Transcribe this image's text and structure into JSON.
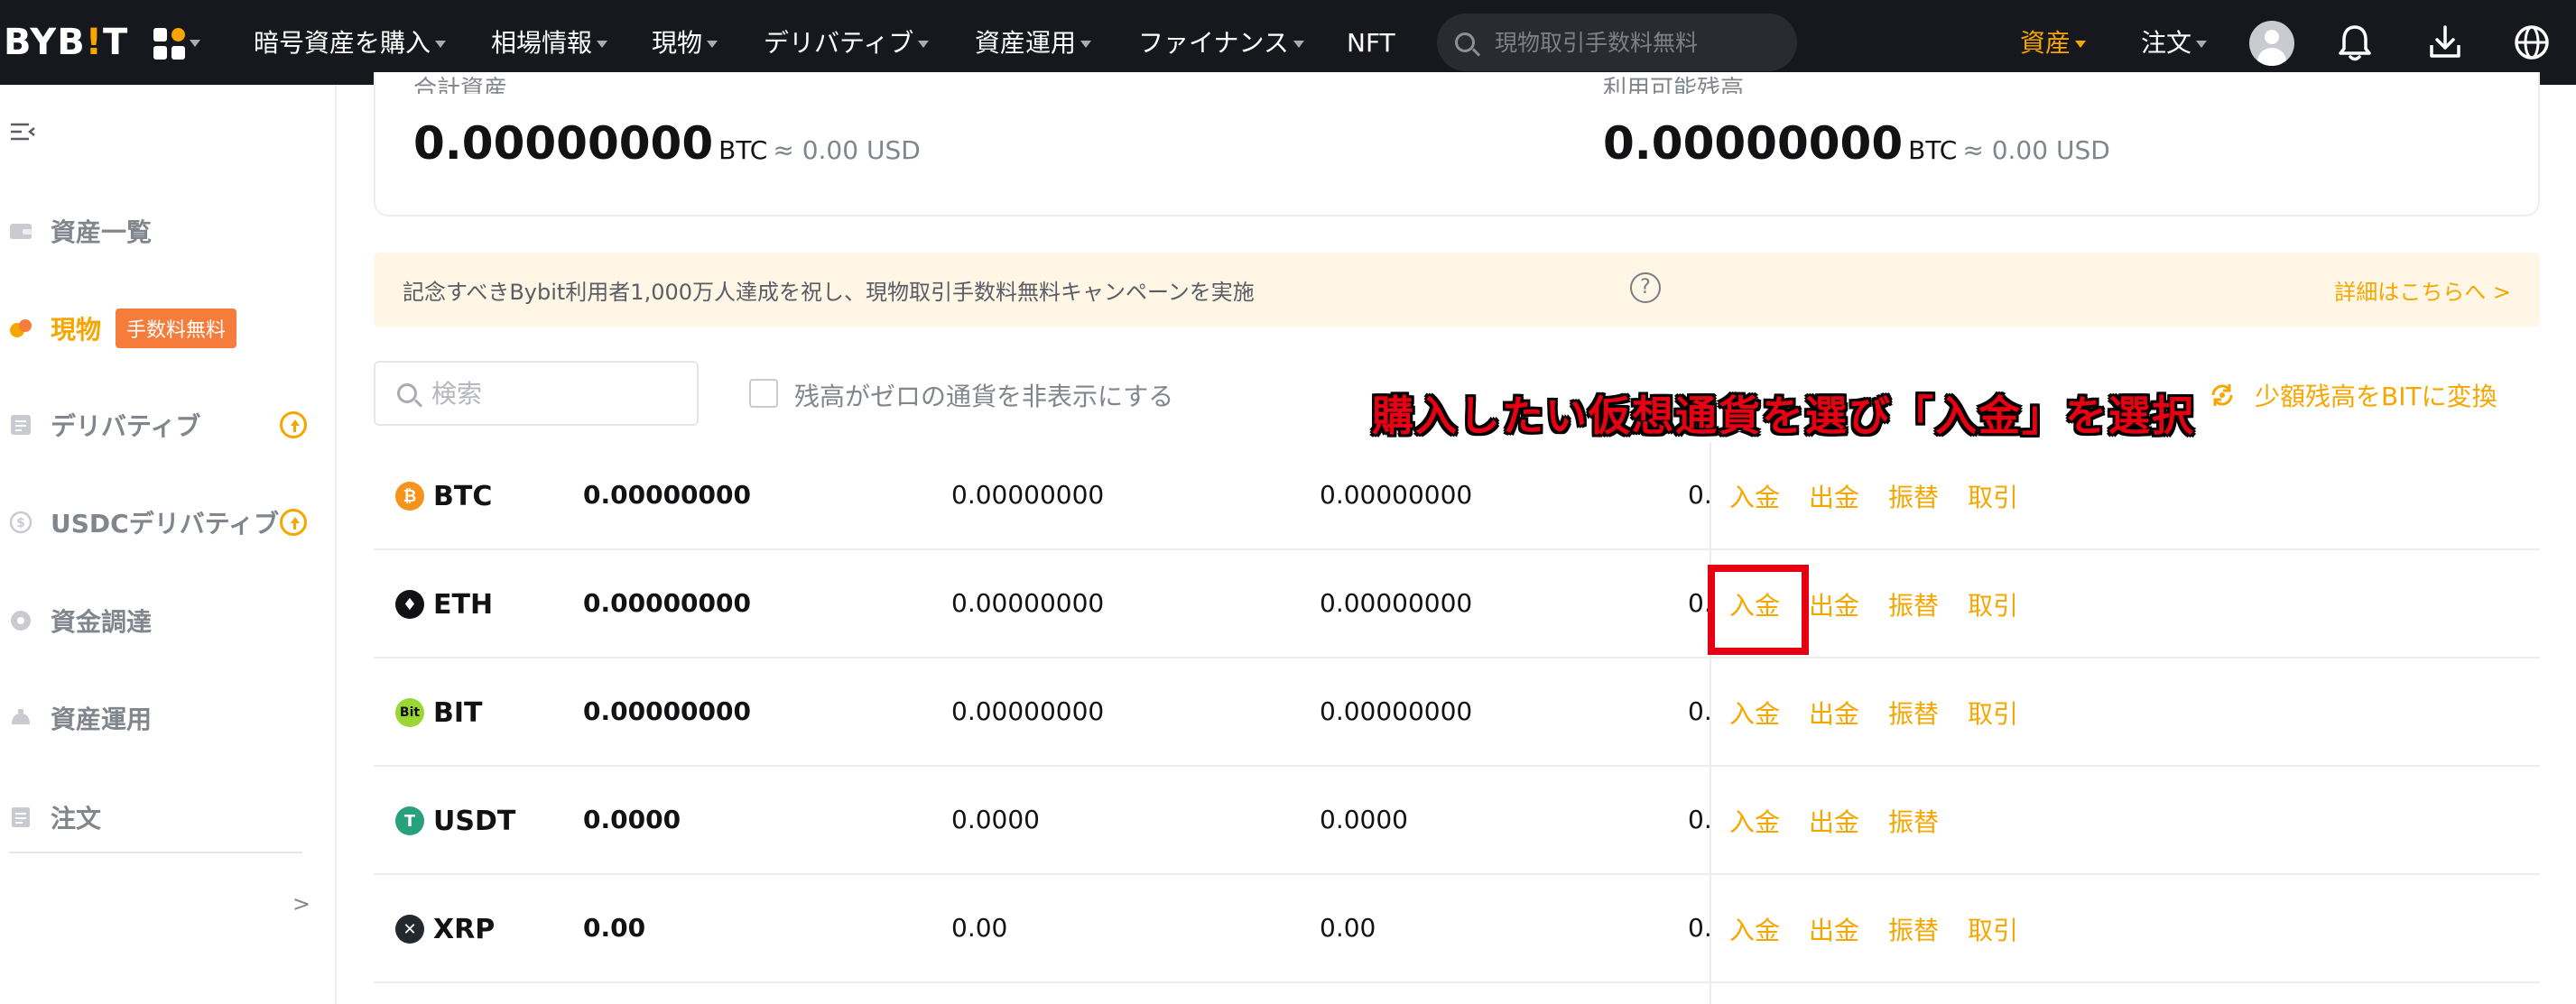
{
  "nav": {
    "logo": "BYB!T",
    "items": [
      "暗号資産を購入",
      "相場情報",
      "現物",
      "デリバティブ",
      "資産運用",
      "ファイナンス",
      "NFT"
    ],
    "search_placeholder": "現物取引手数料無料",
    "assets_label": "資産",
    "orders_label": "注文",
    "accent_color": "#f7a600",
    "icons": [
      "apps-grid-icon",
      "avatar-icon",
      "bell-icon",
      "download-icon",
      "globe-icon"
    ]
  },
  "sidebar": {
    "items": [
      {
        "label": "資産一覧",
        "icon": "wallet-icon"
      },
      {
        "label": "現物",
        "icon": "spot-icon",
        "badge": "手数料無料",
        "active": true
      },
      {
        "label": "デリバティブ",
        "icon": "derivatives-icon",
        "upgrade": true
      },
      {
        "label": "USDCデリバティブ",
        "icon": "usdc-icon",
        "upgrade": true
      },
      {
        "label": "資金調達",
        "icon": "funding-icon"
      },
      {
        "label": "資産運用",
        "icon": "earn-icon"
      },
      {
        "label": "注文",
        "icon": "orders-icon",
        "chevron": ">"
      }
    ]
  },
  "balances": {
    "left_label": "合計資産",
    "left_value": "0.00000000",
    "left_unit": "BTC",
    "left_usd": "≈ 0.00 USD",
    "right_label": "利用可能残高",
    "right_value": "0.00000000",
    "right_unit": "BTC",
    "right_usd": "≈ 0.00 USD"
  },
  "banner": {
    "text": "記念すべきBybit利用者1,000万人達成を祝し、現物取引手数料無料キャンペーンを実施",
    "link": "詳細はこちらへ >"
  },
  "filter": {
    "search_placeholder": "検索",
    "hide_zero_label": "残高がゼロの通貨を非表示にする",
    "convert_label": "少額残高をBITに変換"
  },
  "annotation": "購入したい仮想通貨を選び「入金」を選択",
  "rows": [
    {
      "coin": "BTC",
      "c1": "0.00000000",
      "c2": "0.00000000",
      "c3": "0.00000000",
      "c4": "0.",
      "actions": [
        "入金",
        "出金",
        "振替",
        "取引"
      ],
      "color": "#f7931a"
    },
    {
      "coin": "ETH",
      "c1": "0.00000000",
      "c2": "0.00000000",
      "c3": "0.00000000",
      "c4": "0.",
      "actions": [
        "入金",
        "出金",
        "振替",
        "取引"
      ],
      "color": "#121214"
    },
    {
      "coin": "BIT",
      "c1": "0.00000000",
      "c2": "0.00000000",
      "c3": "0.00000000",
      "c4": "0.",
      "actions": [
        "入金",
        "出金",
        "振替",
        "取引"
      ],
      "color": "#9bd635"
    },
    {
      "coin": "USDT",
      "c1": "0.0000",
      "c2": "0.0000",
      "c3": "0.0000",
      "c4": "0.",
      "actions": [
        "入金",
        "出金",
        "振替"
      ],
      "color": "#26a17b"
    },
    {
      "coin": "XRP",
      "c1": "0.00",
      "c2": "0.00",
      "c3": "0.00",
      "c4": "0.",
      "actions": [
        "入金",
        "出金",
        "振替",
        "取引"
      ],
      "color": "#23292f"
    }
  ]
}
